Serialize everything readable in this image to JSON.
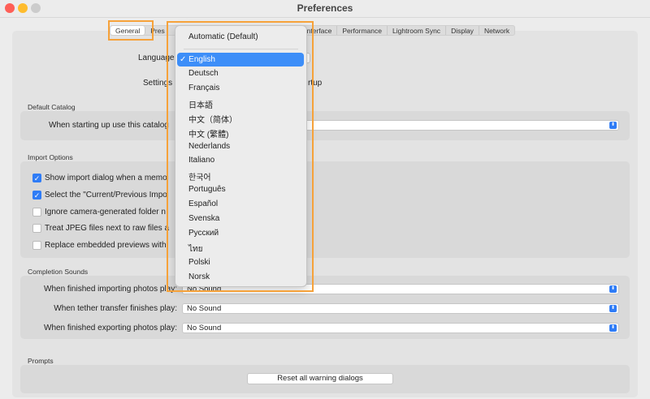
{
  "window": {
    "title": "Preferences"
  },
  "tabs": [
    "General",
    "Pres",
    "Interface",
    "Performance",
    "Lightroom Sync",
    "Display",
    "Network"
  ],
  "general": {
    "language_label": "Language",
    "settings_label": "Settings",
    "settings_tail": "rtup",
    "default_catalog": {
      "section": "Default Catalog",
      "label": "When starting up use this catalog"
    },
    "import_options": {
      "section": "Import Options",
      "items": [
        {
          "label": "Show import dialog when a memo",
          "checked": true
        },
        {
          "label": "Select the \"Current/Previous Impo",
          "checked": true
        },
        {
          "label": "Ignore camera-generated folder n",
          "checked": false
        },
        {
          "label": "Treat JPEG files next to raw files a",
          "checked": false
        },
        {
          "label": "Replace embedded previews with",
          "checked": false
        }
      ]
    },
    "completion_sounds": {
      "section": "Completion Sounds",
      "rows": [
        {
          "label": "When finished importing photos play:",
          "value": "No Sound"
        },
        {
          "label": "When tether transfer finishes play:",
          "value": "No Sound"
        },
        {
          "label": "When finished exporting photos play:",
          "value": "No Sound"
        }
      ]
    },
    "prompts": {
      "section": "Prompts",
      "reset_button": "Reset all warning dialogs"
    }
  },
  "language_menu": {
    "automatic": "Automatic (Default)",
    "selected": "English",
    "check": "✓",
    "items": [
      "Deutsch",
      "Français",
      "日本語",
      "中文（简体）",
      "中文 (繁體)",
      "Nederlands",
      "Italiano",
      "한국어",
      "Português",
      "Español",
      "Svenska",
      "Русский",
      "ไทย",
      "Polski",
      "Norsk"
    ]
  },
  "colors": {
    "accent": "#2f7cf6",
    "highlight": "#f6a23a"
  }
}
